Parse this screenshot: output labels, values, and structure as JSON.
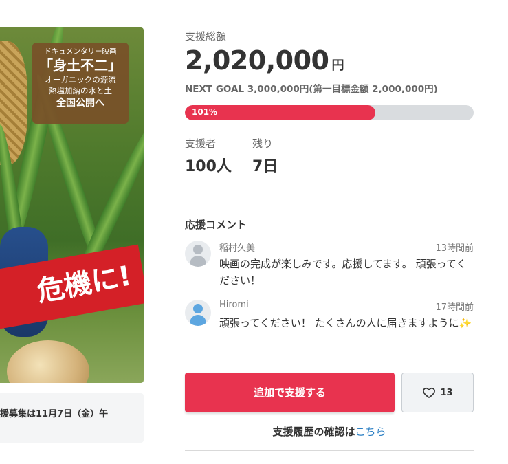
{
  "hero": {
    "sign_line1": "ドキュメンタリー映画",
    "sign_title": "「身土不二」",
    "sign_line3": "オーガニックの源流",
    "sign_line4": "熱塩加納の水と土",
    "sign_line5": "全国公開へ",
    "banner_text": "危機に!",
    "deadline_text": "援募集は11月7日（金）午"
  },
  "funding": {
    "total_label": "支援総額",
    "total_amount": "2,020,000",
    "currency": "円",
    "next_goal": "NEXT GOAL 3,000,000円(第一目標金額 2,000,000円)",
    "progress_percent": 101,
    "progress_label": "101%"
  },
  "stats": {
    "supporters_label": "支援者",
    "supporters_value": "100人",
    "remaining_label": "残り",
    "remaining_value": "7日"
  },
  "comments": {
    "title": "応援コメント",
    "items": [
      {
        "name": "稲村久美",
        "time": "13時間前",
        "text": "映画の完成が楽しみです。応援してます。 頑張ってください！",
        "avatar_color": "#b6bcc3"
      },
      {
        "name": "Hiromi",
        "time": "17時間前",
        "text": "頑張ってください！ たくさんの人に届きますように",
        "emoji": "✨",
        "avatar_color": "#5da6e0"
      }
    ]
  },
  "actions": {
    "support_button": "追加で支援する",
    "like_count": "13",
    "history_text": "支援履歴の確認は",
    "history_link": "こちら"
  },
  "colors": {
    "accent": "#e8334f",
    "progress_track": "#d9dcdf",
    "link": "#2b7fc4"
  }
}
